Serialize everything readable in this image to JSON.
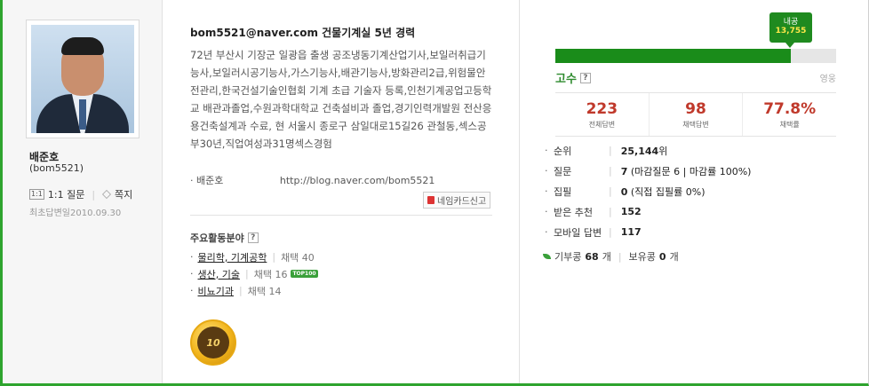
{
  "profile": {
    "name": "배준호",
    "user_id": "(bom5521)",
    "qna_icon": "1:1",
    "qna_label": "1:1 질문",
    "memo_label": "쪽지",
    "first_answer": "최초답변일2010.09.30"
  },
  "bio": {
    "headline": "bom5521@naver.com 건물기계실 5년 경력",
    "text": "72년 부산시 기장군 일광읍 출생 공조냉동기계산업기사,보일러취급기능사,보일러시공기능사,가스기능사,배관기능사,방화관리2급,위험물안전관리,한국건설기술인협회 기계 초급 기술자 등록,인천기계공업고등학교 배관과졸업,수원과학대학교 건축설비과 졸업,경기인력개발원 전산응용건축설계과 수료, 현 서울시 종로구 삼일대로15길26 관철동,섹스공부30년,직업여성과31명섹스경험",
    "blog_label": "· 배준호",
    "blog_url": "http://blog.naver.com/bom5521",
    "report_label": "네임카드신고"
  },
  "areas": {
    "title": "주요활동분야",
    "items": [
      {
        "field": "물리학, 기계공학",
        "adopt": "채택 40",
        "badge": ""
      },
      {
        "field": "생산, 기술",
        "adopt": "채택 16",
        "badge": "TOP100"
      },
      {
        "field": "비뇨기과",
        "adopt": "채택 14",
        "badge": ""
      }
    ],
    "medal_text": "10"
  },
  "level": {
    "tip_label": "내공",
    "tip_value": "13,755",
    "progress_fraction": 0.84,
    "current": "고수",
    "next": "영웅",
    "bar_color": "#1a8c1a"
  },
  "stats": [
    {
      "value": "223",
      "label": "전체답변"
    },
    {
      "value": "98",
      "label": "채택답변"
    },
    {
      "value": "77.8%",
      "label": "채택률"
    }
  ],
  "info": [
    {
      "key": "순위",
      "value": "25,144",
      "suffix": "위"
    },
    {
      "key": "질문",
      "value": "7",
      "suffix": " (마감질문 6  |  마감률 100%)"
    },
    {
      "key": "집필",
      "value": "0",
      "suffix": " (직접 집필률 0%)"
    },
    {
      "key": "받은 추천",
      "value": "152",
      "suffix": ""
    },
    {
      "key": "모바일 답변",
      "value": "117",
      "suffix": ""
    }
  ],
  "beans": {
    "donate_label": "기부콩",
    "donate_value": "68",
    "donate_unit": "개",
    "hold_label": "보유콩",
    "hold_value": "0",
    "hold_unit": "개"
  }
}
